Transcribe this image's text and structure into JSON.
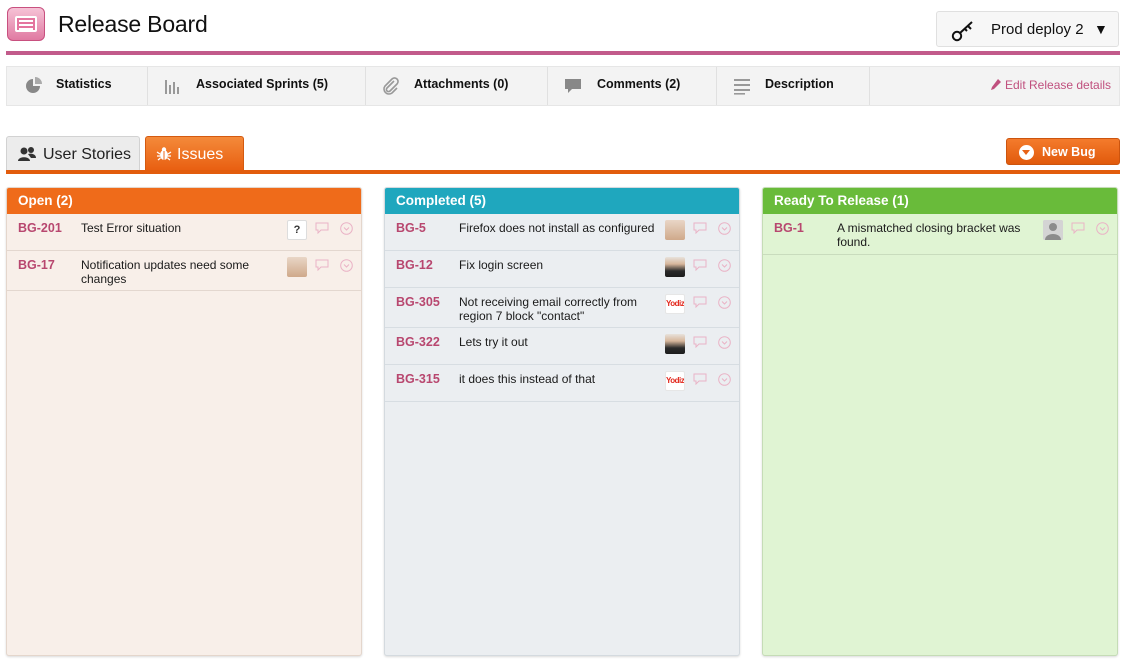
{
  "header": {
    "title": "Release Board",
    "release_select": {
      "label": "Prod deploy 2"
    }
  },
  "toolbar": {
    "items": [
      {
        "label": "Statistics",
        "icon": "pie-chart-icon"
      },
      {
        "label": "Associated Sprints (5)",
        "icon": "bar-chart-icon"
      },
      {
        "label": "Attachments (0)",
        "icon": "paperclip-icon"
      },
      {
        "label": "Comments (2)",
        "icon": "speech-bubble-icon"
      },
      {
        "label": "Description",
        "icon": "lines-icon"
      }
    ],
    "edit_link": "Edit Release details"
  },
  "tabs": [
    {
      "label": "User Stories",
      "icon": "users-icon",
      "active": false
    },
    {
      "label": "Issues",
      "icon": "bug-icon",
      "active": true
    }
  ],
  "new_bug_button": {
    "label": "New Bug"
  },
  "colors": {
    "brand_pink": "#c25b8b",
    "open": "#ef6b1a",
    "completed": "#1fa7be",
    "ready": "#69bb3a",
    "issue_id": "#b8476f"
  },
  "columns": [
    {
      "title": "Open (2)",
      "cards": [
        {
          "id": "BG-201",
          "title": "Test Error situation",
          "avatar": "unknown",
          "avatar_text": "?"
        },
        {
          "id": "BG-17",
          "title": "Notification updates need some changes",
          "avatar": "woman"
        }
      ]
    },
    {
      "title": "Completed (5)",
      "cards": [
        {
          "id": "BG-5",
          "title": "Firefox does not install as configured",
          "avatar": "woman-portrait"
        },
        {
          "id": "BG-12",
          "title": "Fix login screen",
          "avatar": "man"
        },
        {
          "id": "BG-305",
          "title": "Not receiving email correctly from region 7 block \"contact\"",
          "avatar": "yodiz-logo",
          "avatar_text": "Yodiz"
        },
        {
          "id": "BG-322",
          "title": "Lets try it out",
          "avatar": "man"
        },
        {
          "id": "BG-315",
          "title": "it does this instead of that",
          "avatar": "yodiz-logo",
          "avatar_text": "Yodiz"
        }
      ]
    },
    {
      "title": "Ready To Release (1)",
      "cards": [
        {
          "id": "BG-1",
          "title": "A mismatched closing bracket was found.",
          "avatar": "default-person"
        }
      ]
    }
  ]
}
